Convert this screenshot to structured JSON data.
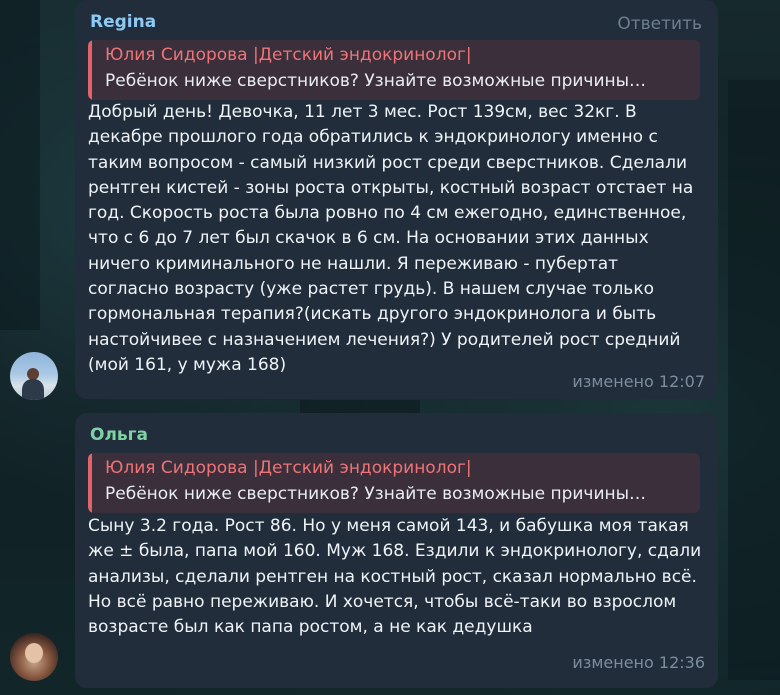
{
  "chat": {
    "messages": [
      {
        "sender": "Regina",
        "sender_color": "#8ccaf5",
        "reply_label": "Ответить",
        "quote_author": "Юлия Сидорова |Детский эндокринолог|",
        "quote_text": "Ребёнок ниже сверстников? Узнайте возможные причины…",
        "text": "Добрый день! Девочка, 11 лет 3 мес. Рост 139см, вес 32кг. В декабре прошлого года обратились к эндокринологу именно с таким вопросом - самый низкий рост среди сверстников. Сделали рентген кистей - зоны роста открыты, костный возраст отстает на год. Скорость роста была ровно по 4 см ежегодно, единственное, что с 6 до 7 лет был скачок в 6 см. На основании этих данных ничего криминального не нашли. Я переживаю - пубертат согласно возрасту (уже растет грудь). В нашем случае только гормональная терапия?(искать другого эндокринолога и быть настойчивее с назначением лечения?) У родителей рост средний (мой 161, у мужа 168)",
        "meta": "изменено 12:07"
      },
      {
        "sender": "Ольга",
        "sender_color": "#7ed3a4",
        "quote_author": "Юлия Сидорова |Детский эндокринолог|",
        "quote_text": "Ребёнок ниже сверстников? Узнайте возможные причины…",
        "text": "Сыну 3.2 года. Рост 86. Но у меня самой 143, и бабушка моя такая же ± была, папа мой 160. Муж 168. Ездили к эндокринологу, сдали анализы, сделали рентген на костный рост, сказал нормально всё. Но всё равно переживаю. И хочется, чтобы всё-таки во взрослом возрасте был как папа ростом, а не как дедушка",
        "meta": "изменено 12:36"
      }
    ]
  }
}
